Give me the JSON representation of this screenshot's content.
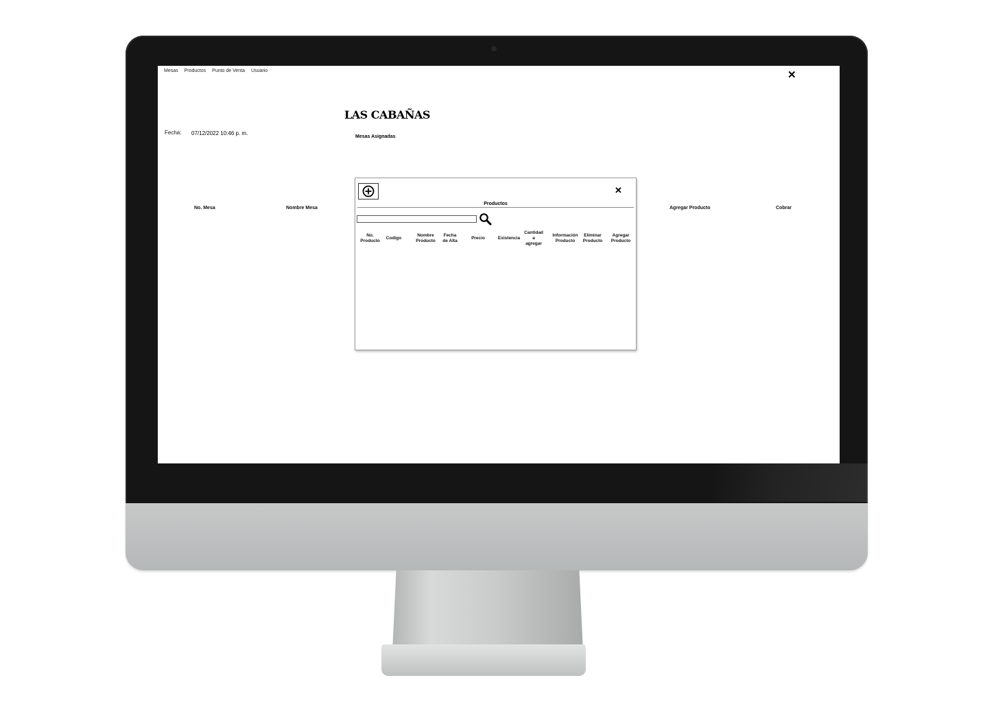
{
  "menu": [
    "Mesas",
    "Productos",
    "Punto de Venta",
    "Usuario"
  ],
  "close_symbol": "✕",
  "app_title": "LAS CABAÑAS",
  "date_label": "Fecha:",
  "date_value": "07/12/2022 10:46 p. m.",
  "mesas_label": "Mesas Asignadas",
  "main_columns": [
    "No. Mesa",
    "Nombre Mesa",
    "Agregar Producto",
    "Cobrar"
  ],
  "dialog": {
    "title": "Productos",
    "add_icon": "plus-circle-icon",
    "search_icon": "magnifier-icon",
    "search_value": "",
    "columns": [
      "No.\nProducto",
      "Codigo",
      "Nombre\nProducto",
      "Fecha\nde Alta",
      "Precio",
      "Existencia",
      "Cantidad\na\nagregar",
      "Información\nProducto",
      "Eliminar\nProducto",
      "Agregar\nProducto"
    ]
  }
}
